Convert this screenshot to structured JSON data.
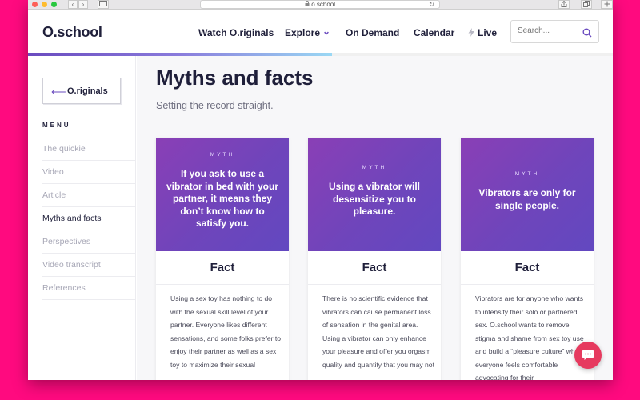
{
  "browser": {
    "url": "o.school",
    "back_glyph": "‹",
    "forward_glyph": "›",
    "reload_glyph": "↻"
  },
  "header": {
    "logo": "O.school",
    "nav": [
      {
        "label": "Watch O.riginals"
      },
      {
        "label": "Explore"
      },
      {
        "label": "On Demand"
      },
      {
        "label": "Calendar"
      },
      {
        "label": "Live"
      }
    ],
    "explore_chevron": "⌄",
    "live_icon": "bolt-icon",
    "search": {
      "placeholder": "Search..."
    },
    "progress_fraction": 0.52,
    "accent_color": "#6a4bbf"
  },
  "sidebar": {
    "back_label": "O.riginals",
    "back_arrow": "⟵",
    "menu_heading": "MENU",
    "items": [
      {
        "label": "The quickie"
      },
      {
        "label": "Video"
      },
      {
        "label": "Article"
      },
      {
        "label": "Myths and facts"
      },
      {
        "label": "Perspectives"
      },
      {
        "label": "Video transcript"
      },
      {
        "label": "References"
      }
    ],
    "active_index": 3
  },
  "main": {
    "title": "Myths and facts",
    "subtitle": "Setting the record straight.",
    "cards": [
      {
        "myth_label": "MYTH",
        "myth_text": "If you ask to use a vibrator in bed with your partner, it means they don’t know how to satisfy you.",
        "fact_heading": "Fact",
        "fact_text": "Using a sex toy has nothing to do with the sexual skill level of your partner. Everyone likes different sensations, and some folks prefer to enjoy their partner as well as a sex toy to maximize their sexual"
      },
      {
        "myth_label": "MYTH",
        "myth_text": "Using a vibrator will desensitize you to pleasure.",
        "fact_heading": "Fact",
        "fact_text": "There is no scientific evidence that vibrators can cause permanent loss of sensation in the genital area. Using a vibrator can only enhance your pleasure and offer you orgasm quality and quantity that you may not"
      },
      {
        "myth_label": "MYTH",
        "myth_text": "Vibrators are only for single people.",
        "fact_heading": "Fact",
        "fact_text": "Vibrators are for anyone who wants to intensify their solo or partnered sex. O.school wants to remove stigma and shame from sex toy use and build a “pleasure culture” where everyone feels comfortable advocating for their"
      }
    ]
  },
  "chat": {
    "icon": "chat-bubble-icon",
    "color": "#e63a5f"
  }
}
